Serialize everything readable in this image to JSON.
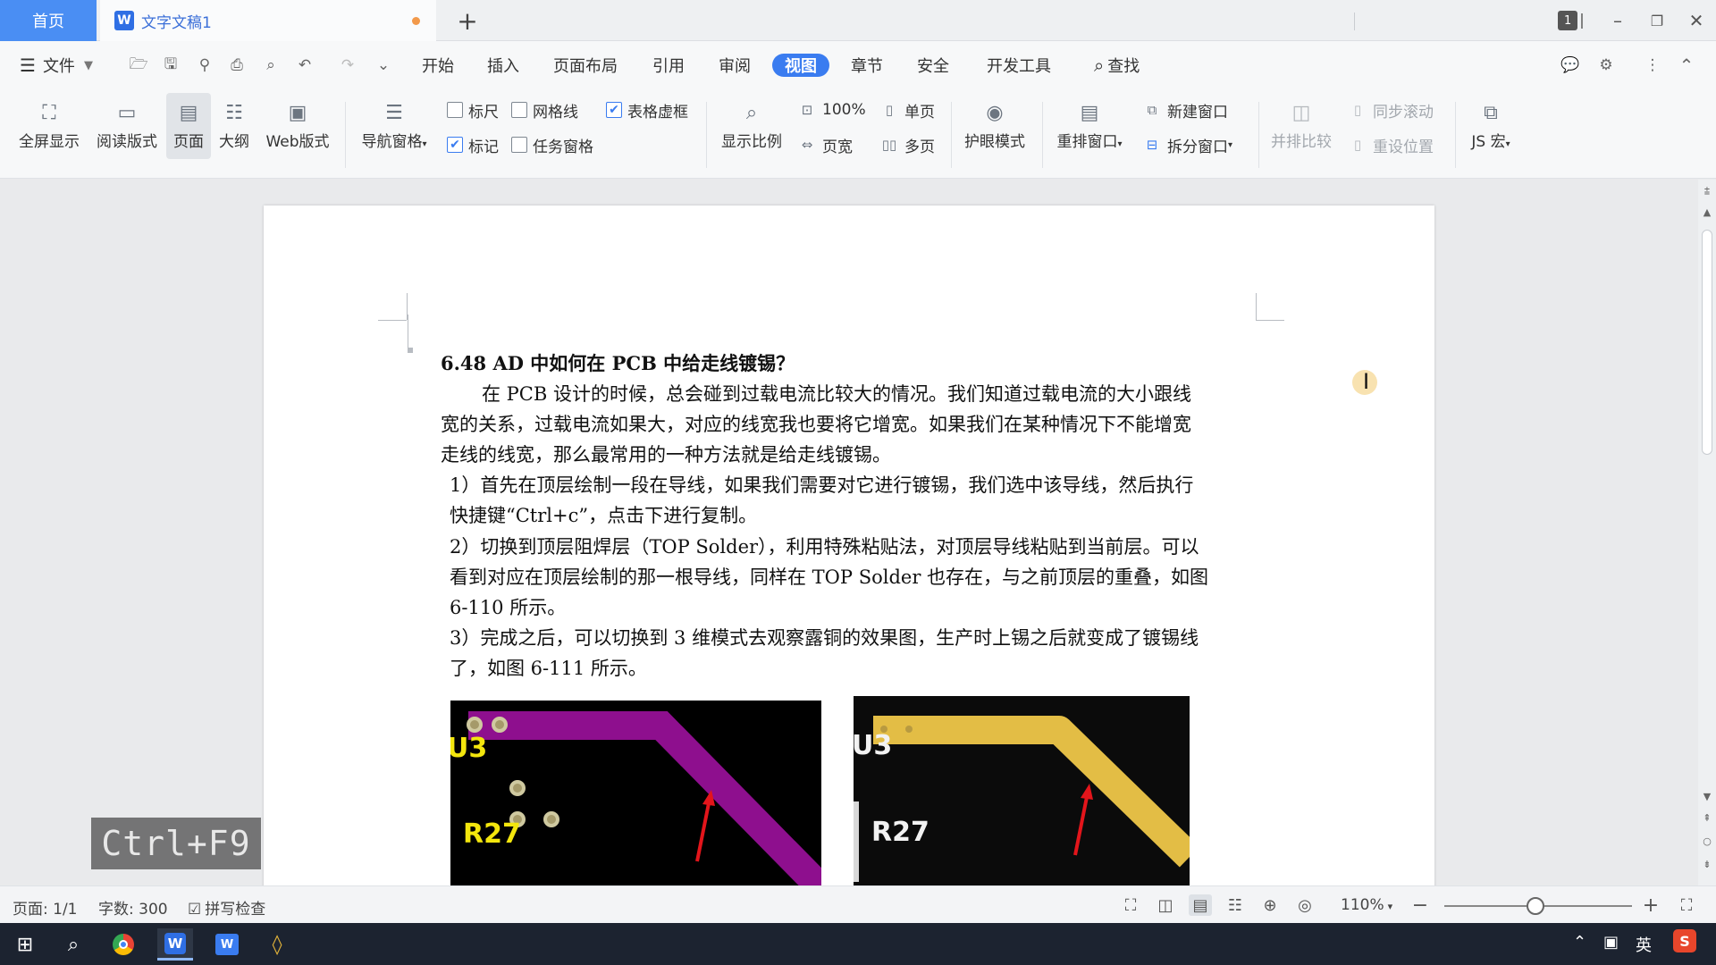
{
  "tabs": {
    "home": "首页",
    "doc_title": "文字文稿1",
    "doc_icon": "W"
  },
  "window": {
    "badge": "1"
  },
  "menu": {
    "file": "文件",
    "items": [
      "开始",
      "插入",
      "页面布局",
      "引用",
      "审阅",
      "视图",
      "章节",
      "安全",
      "开发工具"
    ],
    "active": "视图",
    "search": "查找"
  },
  "ribbon": {
    "fullscreen": "全屏显示",
    "reading": "阅读版式",
    "page": "页面",
    "outline": "大纲",
    "web": "Web版式",
    "nav_pane": "导航窗格",
    "ruler": "标尺",
    "gridlines": "网格线",
    "table_gridlines": "表格虚框",
    "marks": "标记",
    "task_pane": "任务窗格",
    "zoom": "显示比例",
    "zoom_100": "100%",
    "page_width": "页宽",
    "one_page": "单页",
    "multi_page": "多页",
    "eye_care": "护眼模式",
    "rearrange": "重排窗口",
    "new_window": "新建窗口",
    "split_window": "拆分窗口",
    "side_by_side": "并排比较",
    "sync_scroll": "同步滚动",
    "reset_position": "重设位置",
    "js_macro": "JS 宏",
    "checks": {
      "ruler": false,
      "gridlines": false,
      "table_gridlines": true,
      "marks": true,
      "task_pane": false
    }
  },
  "document": {
    "heading": "6.48    AD 中如何在 PCB 中给走线镀锡？",
    "paragraph1": [
      "在 PCB 设计的时候，总会碰到过载电流比较大的情况。我们知道过载电流的大小跟线",
      "宽的关系，过载电流如果大，对应的线宽我也要将它增宽。如果我们在某种情况下不能增宽",
      "走线的线宽，那么最常用的一种方法就是给走线镀锡。"
    ],
    "step1": [
      "1）首先在顶层绘制一段在导线，如果我们需要对它进行镀锡，我们选中该导线，然后执行",
      "快捷键“Ctrl+c”，点击下进行复制。"
    ],
    "step2": [
      "2）切换到顶层阻焊层（TOP Solder），利用特殊粘贴法，对顶层导线粘贴到当前层。可以",
      "看到对应在顶层绘制的那一根导线，同样在 TOP Solder 也存在，与之前顶层的重叠，如图",
      "6-110 所示。"
    ],
    "step3": [
      "3）完成之后，可以切换到 3 维模式去观察露铜的效果图，生产时上锡之后就变成了镀锡线",
      "了，如图 6-111 所示。"
    ],
    "figure_left": {
      "label_u": "U3",
      "label_r": "R27",
      "trace_color": "#8e0f8e"
    },
    "figure_right": {
      "label_u": "U3",
      "label_r": "R27",
      "trace_color": "#e3bd45"
    }
  },
  "overlay": {
    "shortcut": "Ctrl+F9"
  },
  "status": {
    "page": "页面: 1/1",
    "words": "字数: 300",
    "spellcheck": "拼写检查",
    "zoom": "110%"
  },
  "taskbar": {
    "ime": "英"
  }
}
